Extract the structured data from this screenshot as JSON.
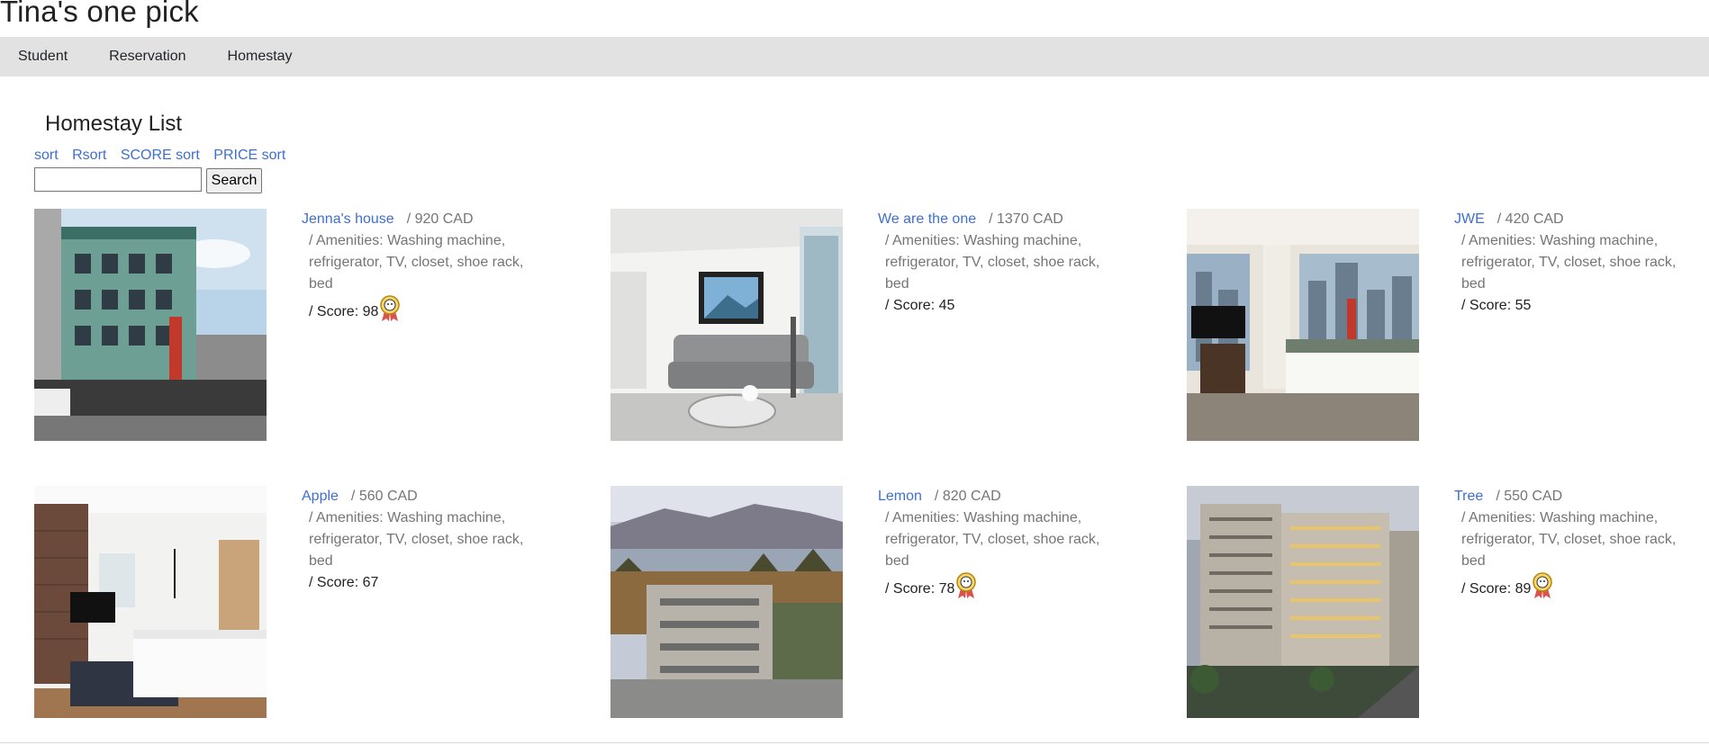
{
  "site": {
    "title": "Tina's one pick"
  },
  "nav": [
    "Student",
    "Reservation",
    "Homestay"
  ],
  "page": {
    "heading": "Homestay List"
  },
  "sort_links": [
    "sort",
    "Rsort",
    "SCORE sort",
    "PRICE sort"
  ],
  "search": {
    "value": "",
    "button_label": "Search"
  },
  "homestays": [
    {
      "name": "Jenna's house",
      "price": "/ 920 CAD",
      "amenities": "/ Amenities: Washing machine, refrigerator, TV, closet, shoe rack, bed",
      "score": "/ Score: 98",
      "badge": true,
      "image": "city street building"
    },
    {
      "name": "We are the one",
      "price": "/ 1370 CAD",
      "amenities": "/ Amenities: Washing machine, refrigerator, TV, closet, shoe rack, bed",
      "score": "/ Score: 45",
      "badge": false,
      "image": "living room with sofa"
    },
    {
      "name": "JWE",
      "price": "/ 420 CAD",
      "amenities": "/ Amenities: Washing machine, refrigerator, TV, closet, shoe rack, bed",
      "score": "/ Score: 55",
      "badge": false,
      "image": "hotel bedroom with city view"
    },
    {
      "name": "Apple",
      "price": "/ 560 CAD",
      "amenities": "/ Amenities: Washing machine, refrigerator, TV, closet, shoe rack, bed",
      "score": "/ Score: 67",
      "badge": false,
      "image": "bedroom with brick wall"
    },
    {
      "name": "Lemon",
      "price": "/ 820 CAD",
      "amenities": "/ Amenities: Washing machine, refrigerator, TV, closet, shoe rack, bed",
      "score": "/ Score: 78",
      "badge": true,
      "image": "building by the water"
    },
    {
      "name": "Tree",
      "price": "/ 550 CAD",
      "amenities": "/ Amenities: Washing machine, refrigerator, TV, closet, shoe rack, bed",
      "score": "/ Score: 89",
      "badge": true,
      "image": "hotel tower at dusk"
    }
  ]
}
